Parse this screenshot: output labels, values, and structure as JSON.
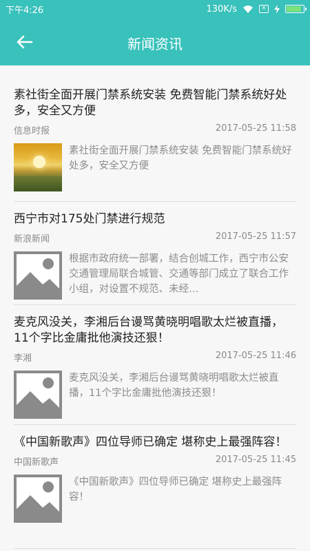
{
  "status_bar": {
    "time": "下午4:26",
    "speed": "130K/s",
    "battery_level": 0.9,
    "sim_icon": "x-box-icon"
  },
  "header": {
    "title": "新闻资讯",
    "back_icon": "back-arrow-icon"
  },
  "news": [
    {
      "title": "素社街全面开展门禁系统安装 免费智能门禁系统好处多，安全又方便",
      "source": "信息时报",
      "time": "2017-05-25 11:58",
      "summary": "素社街全面开展门禁系统安装 免费智能门禁系统好处多，安全又方便",
      "thumb": "sunset-photo"
    },
    {
      "title": "西宁市对175处门禁进行规范",
      "source": "新浪新闻",
      "time": "2017-05-25 11:57",
      "summary": "根据市政府统一部署，结合创城工作，西宁市公安交通管理局联合城管、交通等部门成立了联合工作小组，对设置不规范、未经…",
      "thumb": "image-placeholder-icon"
    },
    {
      "title": "麦克风没关，李湘后台谩骂黄晓明唱歌太烂被直播，11个字比金庸批他演技还狠！",
      "source": "李湘",
      "time": "2017-05-25 11:46",
      "summary": "麦克风没关，李湘后台谩骂黄晓明唱歌太烂被直播，11个字比金庸批他演技还狠！",
      "thumb": "image-placeholder-icon"
    },
    {
      "title": "《中国新歌声》四位导师已确定 堪称史上最强阵容！",
      "source": "中国新歌声",
      "time": "2017-05-25 11:45",
      "summary": "《中国新歌声》四位导师已确定 堪称史上最强阵容！",
      "thumb": "image-placeholder-icon"
    }
  ]
}
